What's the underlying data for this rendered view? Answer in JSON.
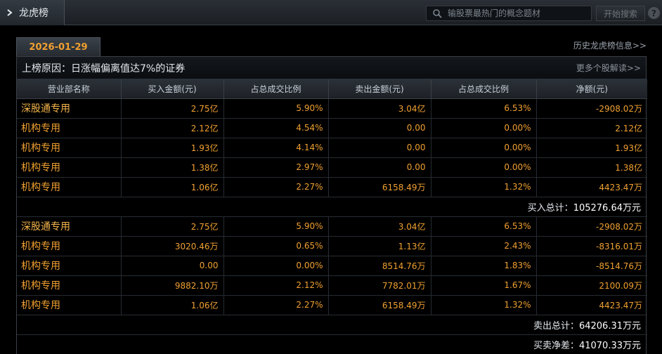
{
  "header": {
    "title": "龙虎榜",
    "search_placeholder": "输股票最热门的概念题材",
    "search_button": "开始搜索",
    "help": "?"
  },
  "date_tab": "2026-01-29",
  "history_link": "历史龙虎榜信息>>",
  "reason": "上榜原因：日涨幅偏离值达7%的证券",
  "more_link": "更多个股解读>>",
  "columns": [
    "营业部名称",
    "买入金额(元)",
    "占总成交比例",
    "卖出金额(元)",
    "占总成交比例",
    "净额(元)"
  ],
  "buy_rows": [
    [
      "深股通专用",
      "2.75亿",
      "5.90%",
      "3.04亿",
      "6.53%",
      "-2908.02万"
    ],
    [
      "机构专用",
      "2.12亿",
      "4.54%",
      "0.00",
      "0.00%",
      "2.12亿"
    ],
    [
      "机构专用",
      "1.93亿",
      "4.14%",
      "0.00",
      "0.00%",
      "1.93亿"
    ],
    [
      "机构专用",
      "1.38亿",
      "2.97%",
      "0.00",
      "0.00%",
      "1.38亿"
    ],
    [
      "机构专用",
      "1.06亿",
      "2.27%",
      "6158.49万",
      "1.32%",
      "4423.47万"
    ]
  ],
  "buy_total_label": "买入总计：",
  "buy_total_value": "105276.64万元",
  "sell_rows": [
    [
      "深股通专用",
      "2.75亿",
      "5.90%",
      "3.04亿",
      "6.53%",
      "-2908.02万"
    ],
    [
      "机构专用",
      "3020.46万",
      "0.65%",
      "1.13亿",
      "2.43%",
      "-8316.01万"
    ],
    [
      "机构专用",
      "0.00",
      "0.00%",
      "8514.76万",
      "1.83%",
      "-8514.76万"
    ],
    [
      "机构专用",
      "9882.10万",
      "2.12%",
      "7782.01万",
      "1.67%",
      "2100.09万"
    ],
    [
      "机构专用",
      "1.06亿",
      "2.27%",
      "6158.49万",
      "1.32%",
      "4423.47万"
    ]
  ],
  "sell_total_label": "卖出总计：",
  "sell_total_value": "64206.31万元",
  "net_label": "买卖净差：",
  "net_value": "41070.33万元"
}
